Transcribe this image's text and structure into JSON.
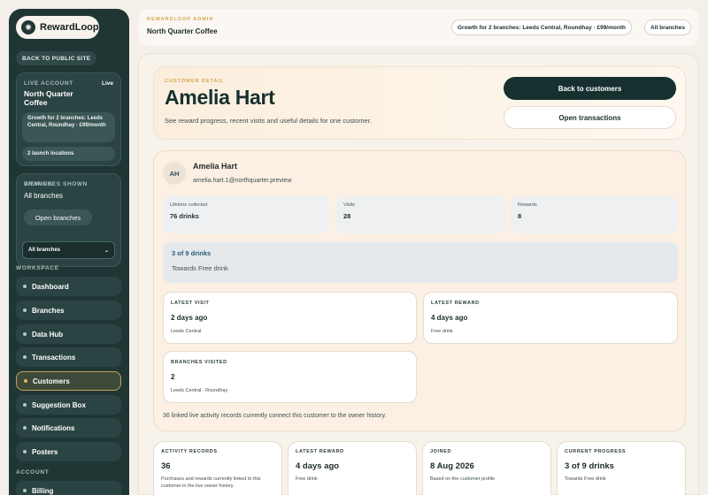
{
  "brand": {
    "name": "RewardLoop",
    "logo_icon": "loop-icon"
  },
  "sidebar": {
    "back_public": "BACK TO PUBLIC SITE",
    "live_account": {
      "label": "LIVE ACCOUNT",
      "status": "Live",
      "name": "North Quarter Coffee",
      "growth": "Growth for 2 branches: Leeds Central, Roundhay · £99/month",
      "launch": "2 launch locations"
    },
    "branches": {
      "label": "BRANCHES SHOWN",
      "value": "All branches",
      "open_button": "Open branches",
      "viewing_label": "VIEWING",
      "viewing_value": "All branches"
    },
    "workspace_label": "WORKSPACE",
    "items": [
      {
        "label": "Dashboard"
      },
      {
        "label": "Branches"
      },
      {
        "label": "Data Hub"
      },
      {
        "label": "Transactions"
      },
      {
        "label": "Customers"
      },
      {
        "label": "Suggestion Box"
      },
      {
        "label": "Notifications"
      },
      {
        "label": "Posters"
      }
    ],
    "account_label": "ACCOUNT",
    "account_items": [
      {
        "label": "Billing"
      }
    ],
    "active_item": "Customers"
  },
  "topbar": {
    "kicker": "REWARDLOOP ADMIN",
    "title": "North Quarter Coffee",
    "plan_pill": "Growth for 2 branches: Leeds Central, Roundhay · £99/month",
    "branch_pill": "All branches"
  },
  "hero": {
    "kicker": "CUSTOMER DETAIL",
    "title": "Amelia Hart",
    "subtitle": "See reward progress, recent visits and useful details for one customer.",
    "back_button": "Back to customers",
    "transactions_button": "Open transactions"
  },
  "customer": {
    "initials": "AH",
    "name": "Amelia Hart",
    "email": "amelia.hart.1@northquarter.preview",
    "stats": [
      {
        "label": "Lifetime collected",
        "value": "76 drinks"
      },
      {
        "label": "Visits",
        "value": "28"
      },
      {
        "label": "Rewards",
        "value": "8"
      }
    ],
    "progress": {
      "label": "3 of 9 drinks",
      "sub": "Towards Free drink"
    },
    "latest_visit": {
      "kicker": "LATEST VISIT",
      "value": "2 days ago",
      "sub": "Leeds Central"
    },
    "latest_reward": {
      "kicker": "LATEST REWARD",
      "value": "4 days ago",
      "sub": "Free drink"
    },
    "branches_visited": {
      "kicker": "BRANCHES VISITED",
      "value": "2",
      "sub": "Leeds Central · Roundhay"
    },
    "linked_note": "36 linked live activity records currently connect this customer to the owner history."
  },
  "summary_cards": [
    {
      "kicker": "ACTIVITY RECORDS",
      "value": "36",
      "sub": "Purchases and rewards currently linked to this customer in the live owner history"
    },
    {
      "kicker": "LATEST REWARD",
      "value": "4 days ago",
      "sub": "Free drink"
    },
    {
      "kicker": "JOINED",
      "value": "8 Aug 2026",
      "sub": "Based on the customer profile"
    },
    {
      "kicker": "CURRENT PROGRESS",
      "value": "3 of 9 drinks",
      "sub": "Towards Free drink"
    }
  ],
  "colors": {
    "sidebar": "#1f3635",
    "accent": "#d4a44a",
    "primary_button": "#16302f"
  }
}
